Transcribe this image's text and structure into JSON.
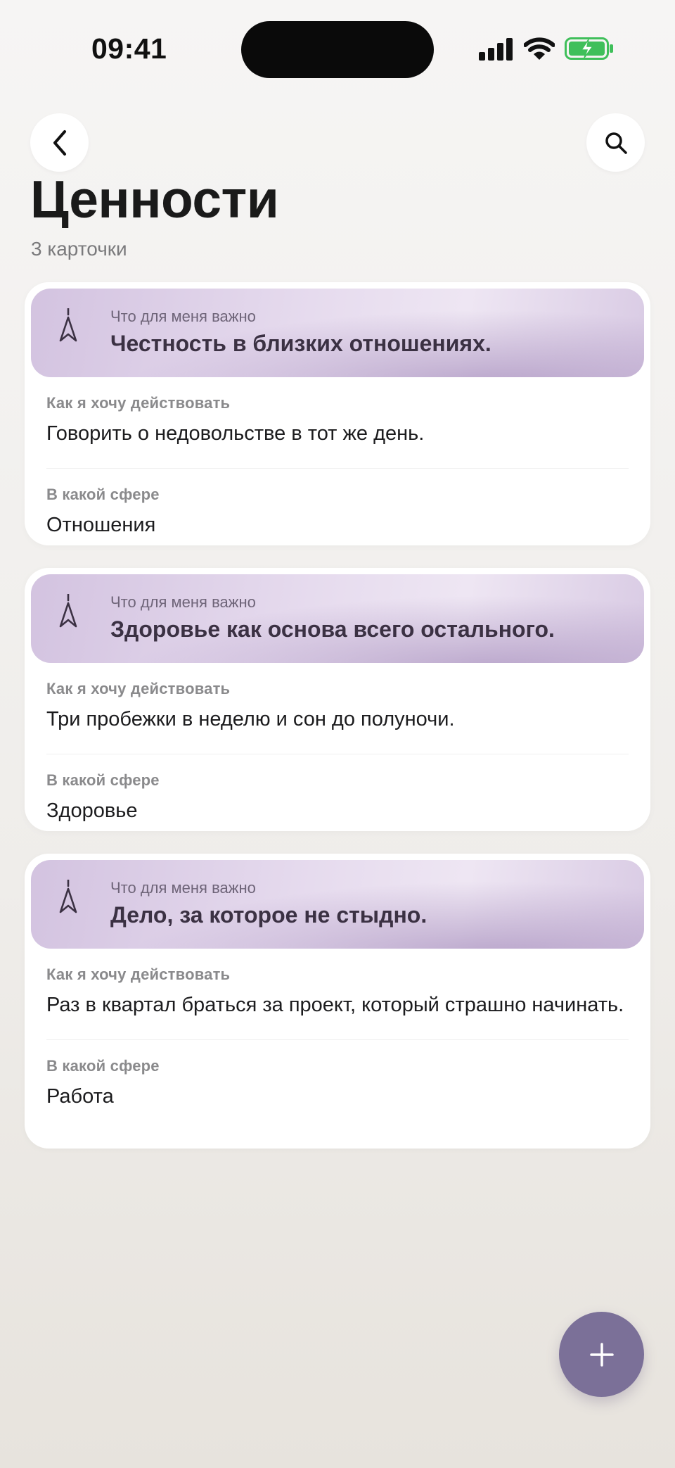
{
  "status_bar": {
    "time": "09:41",
    "icons": [
      "cellular-signal-icon",
      "wifi-icon",
      "battery-charging-icon"
    ],
    "battery_color": "#3fbf5a"
  },
  "header": {
    "back_icon": "chevron-left-icon",
    "search_icon": "search-icon",
    "title": "Ценности",
    "subtitle": "3 карточки"
  },
  "cards": [
    {
      "icon": "compass-icon",
      "important_label": "Что для меня важно",
      "important_value": "Честность в близких отношениях.",
      "action_label": "Как я хочу действовать",
      "action_value": "Говорить о недовольстве в тот же день.",
      "sphere_label": "В какой сфере",
      "sphere_value": "Отношения"
    },
    {
      "icon": "compass-icon",
      "important_label": "Что для меня важно",
      "important_value": "Здоровье как основа всего остального.",
      "action_label": "Как я хочу действовать",
      "action_value": "Три пробежки в неделю и сон до полуночи.",
      "sphere_label": "В какой сфере",
      "sphere_value": "Здоровье"
    },
    {
      "icon": "compass-icon",
      "important_label": "Что для меня важно",
      "important_value": "Дело, за которое не стыдно.",
      "action_label": "Как я хочу действовать",
      "action_value": "Раз в квартал браться за проект, который страшно начинать.",
      "sphere_label": "В какой сфере",
      "sphere_value": "Работа"
    }
  ],
  "fab": {
    "icon": "plus-icon",
    "color": "#7b7098"
  },
  "colors": {
    "accent": "#7b7098",
    "card_header": "#e2d6ec"
  }
}
